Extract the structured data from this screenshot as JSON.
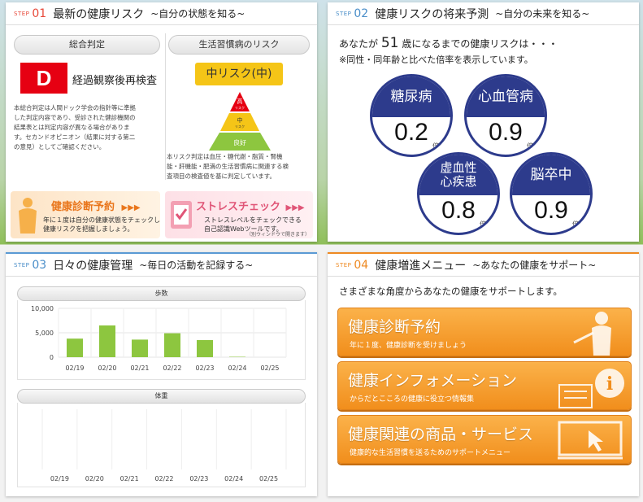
{
  "step01": {
    "tag": "STEP",
    "num": "01",
    "title": "最新の健康リスク",
    "subtitle": "~自分の状態を知る~",
    "overall_label": "総合判定",
    "grade": "D",
    "grade_text": "経過観察後再検査",
    "overall_note": [
      "本総合判定は人間ドック学会の指針等に準拠",
      "した判定内容であり、受診された健診機関の",
      "結果表とは判定内容が異なる場合がありま",
      "す。セカンドオピニオン（結果に対する第二",
      "の意見）としてご確認ください。"
    ],
    "lifestyle_label": "生活習慣病のリスク",
    "risk_badge": "中リスク(中)",
    "pyramid": {
      "high": "高",
      "high_sub": "リスク",
      "mid": "中",
      "mid_sub": "リスク",
      "low": "良好"
    },
    "risk_note": [
      "本リスク判定は血圧・糖代謝・脂質・腎機",
      "能・肝機能・肥満の生活習慣病に関連する検",
      "査項目の検査値を基に判定しています。"
    ],
    "banner_left": {
      "title": "健康診断予約",
      "arrows": "▶▶▶",
      "text": [
        "年に１度は自分の健康状態をチェックし",
        "健康リスクを把握しましょう。"
      ]
    },
    "banner_right": {
      "title": "ストレスチェック",
      "arrows": "▶▶▶",
      "text": [
        "ストレスレベルをチェックできる",
        "自己認識Webツールです。"
      ],
      "note": "（別ウィンドウで開きます）"
    }
  },
  "step02": {
    "tag": "STEP",
    "num": "02",
    "title": "健康リスクの将来予測",
    "subtitle": "~自分の未来を知る~",
    "line1_pre": "あなたが",
    "age": "51",
    "line1_post": "歳になるまでの健康リスクは・・・",
    "line2": "※同性・同年齢と比べた倍率を表示しています。",
    "unit": "倍",
    "risks": [
      {
        "name": "糖尿病",
        "value": "0.2"
      },
      {
        "name": "心血管病",
        "value": "0.9"
      },
      {
        "name1": "虚血性",
        "name2": "心疾患",
        "value": "0.8"
      },
      {
        "name": "脳卒中",
        "value": "0.9"
      }
    ],
    "color_dark_blue": "#2d3b8c"
  },
  "step03": {
    "tag": "STEP",
    "num": "03",
    "title": "日々の健康管理",
    "subtitle": "~毎日の活動を記録する~",
    "steps_label": "歩数",
    "weight_label": "体重",
    "chart_data": [
      {
        "type": "bar",
        "title": "歩数",
        "categories": [
          "02/19",
          "02/20",
          "02/21",
          "02/22",
          "02/23",
          "02/24",
          "02/25"
        ],
        "values": [
          3800,
          6500,
          3600,
          4900,
          3500,
          80,
          0
        ],
        "yticks": [
          "10,000",
          "5,000",
          "0"
        ],
        "ylim": [
          0,
          10000
        ],
        "color": "#8dc63f"
      },
      {
        "type": "line",
        "title": "体重",
        "categories": [
          "02/19",
          "02/20",
          "02/21",
          "02/22",
          "02/23",
          "02/24",
          "02/25"
        ],
        "values": []
      }
    ]
  },
  "step04": {
    "tag": "STEP",
    "num": "04",
    "title": "健康増進メニュー",
    "subtitle": "~あなたの健康をサポート~",
    "intro": "さまざまな角度からあなたの健康をサポートします。",
    "menu": [
      {
        "title": "健康診断予約",
        "sub": "年に１度、健康診断を受けましょう",
        "icon": "presenter-icon"
      },
      {
        "title": "健康インフォメーション",
        "sub": "からだとこころの健康に役立つ情報集",
        "icon": "info-icon"
      },
      {
        "title": "健康関連の商品・サービス",
        "sub": "健康的な生活習慣を送るためのサポートメニュー",
        "icon": "monitor-cursor-icon"
      }
    ]
  }
}
